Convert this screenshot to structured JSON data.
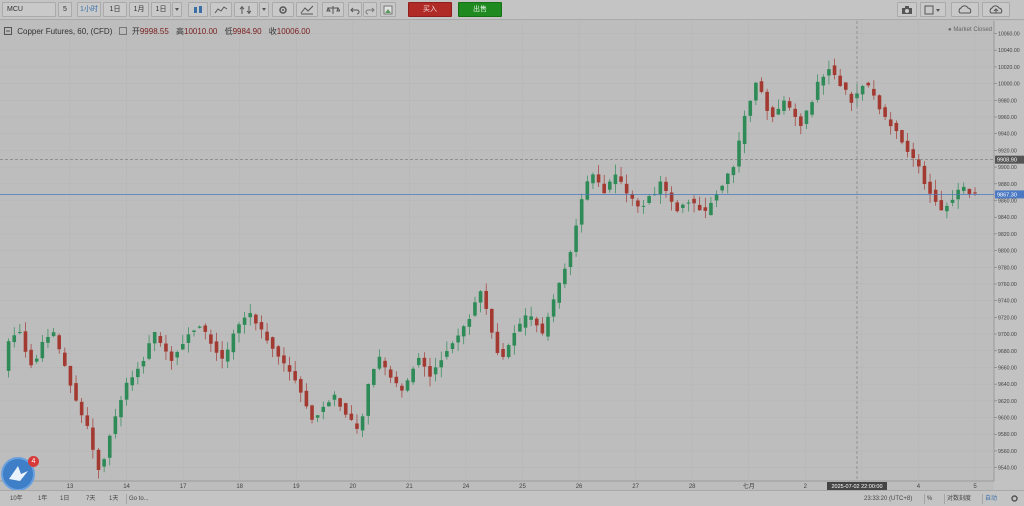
{
  "toolbar": {
    "symbol": "MCU",
    "interval_dropdown": "5",
    "intervals": [
      "1小时",
      "1日",
      "1月",
      "1日"
    ],
    "buy_label": "买入",
    "sell_label": "出售"
  },
  "legend": {
    "instrument": "Copper Futures, 60, (CFD)",
    "open_label": "开",
    "open": "9998.55",
    "high_label": "高",
    "high": "10010.00",
    "low_label": "低",
    "low": "9984.90",
    "close_label": "收",
    "close": "10006.00",
    "market_status": "Market Closed"
  },
  "crosshair": {
    "price": "9908.90",
    "time_label": "2025-07-02 22:00:00"
  },
  "last_price": "9867.30",
  "bottom": {
    "ranges": [
      "10年",
      "1年",
      "1日",
      "7天",
      "1天"
    ],
    "goto_label": "Go to...",
    "clock": "23:33:20 (UTC+8)",
    "percent": "%",
    "log": "对数刻度",
    "auto": "自动"
  },
  "logo_badge": "4",
  "colors": {
    "up": "#2e8b57",
    "down": "#a33a32",
    "grid": "#b5b5b5",
    "last_price": "#4a78c2"
  },
  "chart_data": {
    "type": "candlestick",
    "symbol": "Copper Futures",
    "interval": "60",
    "x_labels": [
      "13",
      "14",
      "17",
      "18",
      "19",
      "20",
      "21",
      "24",
      "25",
      "26",
      "27",
      "28",
      "七月",
      "2",
      "3",
      "4",
      "5"
    ],
    "y_ticks": [
      9540,
      9560,
      9580,
      9600,
      9620,
      9640,
      9660,
      9680,
      9700,
      9720,
      9740,
      9760,
      9780,
      9800,
      9820,
      9840,
      9860,
      9880,
      9900,
      9920,
      9940,
      9960,
      9980,
      10000,
      10020,
      10040,
      10060
    ],
    "ylim": [
      9524,
      10075
    ],
    "close_path": [
      9655,
      9690,
      9700,
      9705,
      9680,
      9665,
      9670,
      9690,
      9695,
      9700,
      9680,
      9660,
      9640,
      9620,
      9600,
      9590,
      9560,
      9540,
      9550,
      9580,
      9600,
      9620,
      9640,
      9650,
      9660,
      9670,
      9690,
      9700,
      9690,
      9680,
      9670,
      9680,
      9690,
      9700,
      9705,
      9710,
      9700,
      9690,
      9680,
      9670,
      9680,
      9700,
      9710,
      9720,
      9725,
      9715,
      9705,
      9695,
      9685,
      9675,
      9665,
      9655,
      9645,
      9630,
      9615,
      9600,
      9605,
      9615,
      9620,
      9625,
      9615,
      9605,
      9595,
      9585,
      9600,
      9640,
      9660,
      9670,
      9660,
      9650,
      9640,
      9630,
      9645,
      9660,
      9670,
      9660,
      9650,
      9660,
      9670,
      9680,
      9690,
      9700,
      9710,
      9720,
      9740,
      9750,
      9730,
      9700,
      9680,
      9670,
      9685,
      9700,
      9710,
      9720,
      9720,
      9710,
      9700,
      9720,
      9740,
      9760,
      9780,
      9800,
      9830,
      9860,
      9880,
      9890,
      9880,
      9870,
      9880,
      9890,
      9880,
      9870,
      9860,
      9850,
      9855,
      9865,
      9870,
      9880,
      9870,
      9860,
      9850,
      9855,
      9860,
      9855,
      9850,
      9845,
      9860,
      9870,
      9880,
      9890,
      9900,
      9930,
      9960,
      9980,
      10000,
      9990,
      9970,
      9960,
      9970,
      9980,
      9970,
      9960,
      9950,
      9965,
      9980,
      10000,
      10010,
      10020,
      10010,
      10000,
      9990,
      9980,
      9990,
      10000,
      9995,
      9985,
      9970,
      9960,
      9950,
      9945,
      9930,
      9920,
      9910,
      9900,
      9880,
      9870,
      9860,
      9850,
      9855,
      9860,
      9870,
      9875,
      9870,
      9868
    ]
  }
}
